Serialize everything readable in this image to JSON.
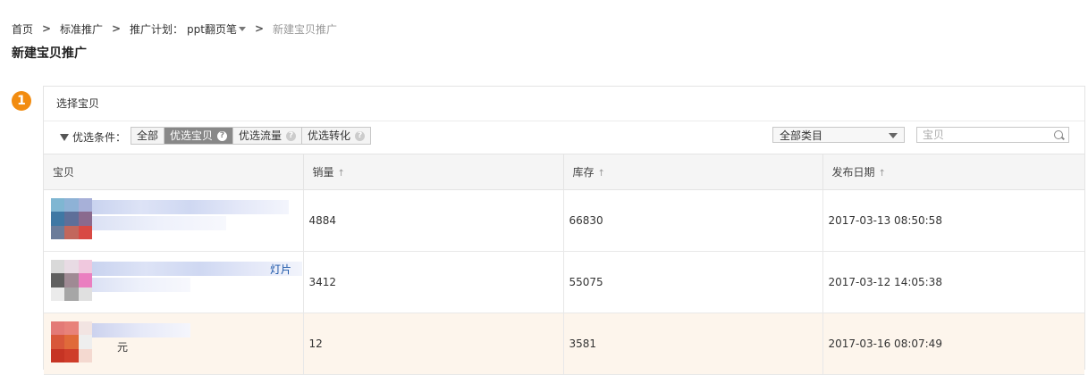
{
  "breadcrumb": {
    "home": "首页",
    "standard": "标准推广",
    "plan_label": "推广计划：",
    "plan_name": "ppt翻页笔",
    "current": "新建宝贝推广"
  },
  "page_title": "新建宝贝推广",
  "step": {
    "number": "1",
    "title": "选择宝贝"
  },
  "filter": {
    "label": "优选条件：",
    "options": [
      "全部",
      "优选宝贝",
      "优选流量",
      "优选转化"
    ],
    "active_option": "优选宝贝",
    "category_select": "全部类目",
    "search_placeholder": "宝贝"
  },
  "table": {
    "columns": [
      "宝贝",
      "销量",
      "库存",
      "发布日期"
    ],
    "sort_icon": "↑",
    "rows": [
      {
        "title_visible": "",
        "sales": "4884",
        "stock": "66830",
        "date": "2017-03-13 08:50:58",
        "highlighted": false
      },
      {
        "title_visible": "灯片",
        "sales": "3412",
        "stock": "55075",
        "date": "2017-03-12 14:05:38",
        "highlighted": false
      },
      {
        "title_visible": "元",
        "sales": "12",
        "stock": "3581",
        "date": "2017-03-16 08:07:49",
        "highlighted": true
      }
    ]
  },
  "colors": {
    "accent_orange": "#f28c10",
    "active_segment": "#888888",
    "highlight_row": "#fdf5ec",
    "link_blue": "#1a55a8"
  }
}
